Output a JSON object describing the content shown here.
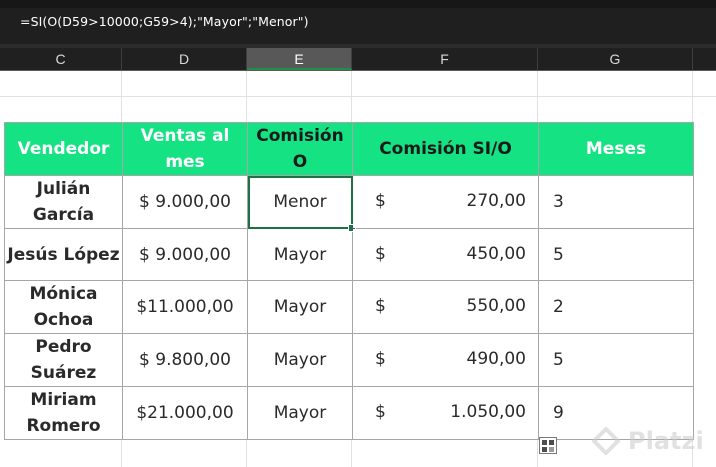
{
  "formula_bar": {
    "formula": "=SI(O(D59>10000;G59>4);\"Mayor\";\"Menor\")"
  },
  "columns": [
    "C",
    "D",
    "E",
    "F",
    "G"
  ],
  "selected_column": "E",
  "table": {
    "headers": {
      "vendedor": "Vendedor",
      "ventas": "Ventas al mes",
      "comision_o": "Comisión O",
      "comision_si_o": "Comisión SI/O",
      "meses": "Meses"
    },
    "rows": [
      {
        "vendedor": "Julián García",
        "ventas": "$  9.000,00",
        "comision_o": "Menor",
        "comision_sym": "$",
        "comision_si_o": "270,00",
        "meses": "3"
      },
      {
        "vendedor": "Jesús López",
        "ventas": "$  9.000,00",
        "comision_o": "Mayor",
        "comision_sym": "$",
        "comision_si_o": "450,00",
        "meses": "5"
      },
      {
        "vendedor": "Mónica Ochoa",
        "ventas": "$11.000,00",
        "comision_o": "Mayor",
        "comision_sym": "$",
        "comision_si_o": "550,00",
        "meses": "2"
      },
      {
        "vendedor": "Pedro Suárez",
        "ventas": "$  9.800,00",
        "comision_o": "Mayor",
        "comision_sym": "$",
        "comision_si_o": "490,00",
        "meses": "5"
      },
      {
        "vendedor": "Miriam Romero",
        "ventas": "$21.000,00",
        "comision_o": "Mayor",
        "comision_sym": "$",
        "comision_si_o": "1.050,00",
        "meses": "9"
      }
    ]
  },
  "watermark": {
    "text": "Platzi"
  },
  "colors": {
    "header_fill": "#15e283",
    "selection": "#1e7145",
    "formula_bar_bg": "#1f1f1f"
  },
  "icons": {
    "paste_options": "paste-options-icon",
    "watermark_logo": "platzi-logo-icon"
  }
}
